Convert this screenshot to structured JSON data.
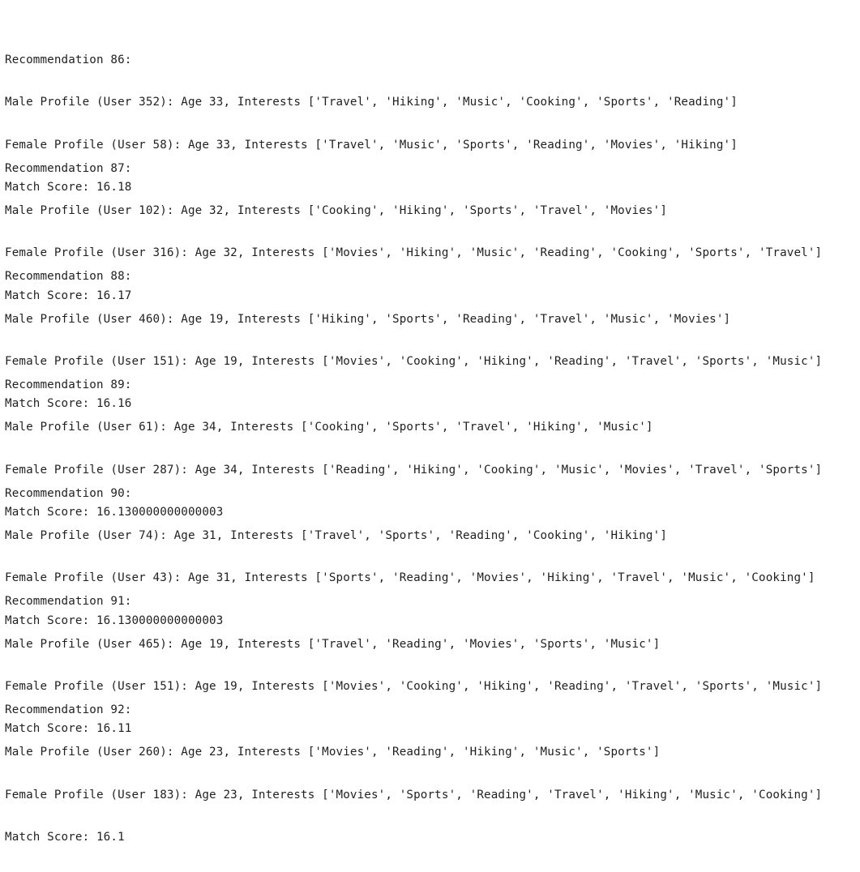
{
  "recommendations": [
    {
      "header": "Recommendation 86:",
      "male": "Male Profile (User 352): Age 33, Interests ['Travel', 'Hiking', 'Music', 'Cooking', 'Sports', 'Reading']",
      "female": "Female Profile (User 58): Age 33, Interests ['Travel', 'Music', 'Sports', 'Reading', 'Movies', 'Hiking']",
      "score": "Match Score: 16.18"
    },
    {
      "header": "Recommendation 87:",
      "male": "Male Profile (User 102): Age 32, Interests ['Cooking', 'Hiking', 'Sports', 'Travel', 'Movies']",
      "female": "Female Profile (User 316): Age 32, Interests ['Movies', 'Hiking', 'Music', 'Reading', 'Cooking', 'Sports', 'Travel']",
      "score": "Match Score: 16.17"
    },
    {
      "header": "Recommendation 88:",
      "male": "Male Profile (User 460): Age 19, Interests ['Hiking', 'Sports', 'Reading', 'Travel', 'Music', 'Movies']",
      "female": "Female Profile (User 151): Age 19, Interests ['Movies', 'Cooking', 'Hiking', 'Reading', 'Travel', 'Sports', 'Music']",
      "score": "Match Score: 16.16"
    },
    {
      "header": "Recommendation 89:",
      "male": "Male Profile (User 61): Age 34, Interests ['Cooking', 'Sports', 'Travel', 'Hiking', 'Music']",
      "female": "Female Profile (User 287): Age 34, Interests ['Reading', 'Hiking', 'Cooking', 'Music', 'Movies', 'Travel', 'Sports']",
      "score": "Match Score: 16.130000000000003"
    },
    {
      "header": "Recommendation 90:",
      "male": "Male Profile (User 74): Age 31, Interests ['Travel', 'Sports', 'Reading', 'Cooking', 'Hiking']",
      "female": "Female Profile (User 43): Age 31, Interests ['Sports', 'Reading', 'Movies', 'Hiking', 'Travel', 'Music', 'Cooking']",
      "score": "Match Score: 16.130000000000003"
    },
    {
      "header": "Recommendation 91:",
      "male": "Male Profile (User 465): Age 19, Interests ['Travel', 'Reading', 'Movies', 'Sports', 'Music']",
      "female": "Female Profile (User 151): Age 19, Interests ['Movies', 'Cooking', 'Hiking', 'Reading', 'Travel', 'Sports', 'Music']",
      "score": "Match Score: 16.11"
    },
    {
      "header": "Recommendation 92:",
      "male": "Male Profile (User 260): Age 23, Interests ['Movies', 'Reading', 'Hiking', 'Music', 'Sports']",
      "female": "Female Profile (User 183): Age 23, Interests ['Movies', 'Sports', 'Reading', 'Travel', 'Hiking', 'Music', 'Cooking']",
      "score": "Match Score: 16.1"
    }
  ]
}
